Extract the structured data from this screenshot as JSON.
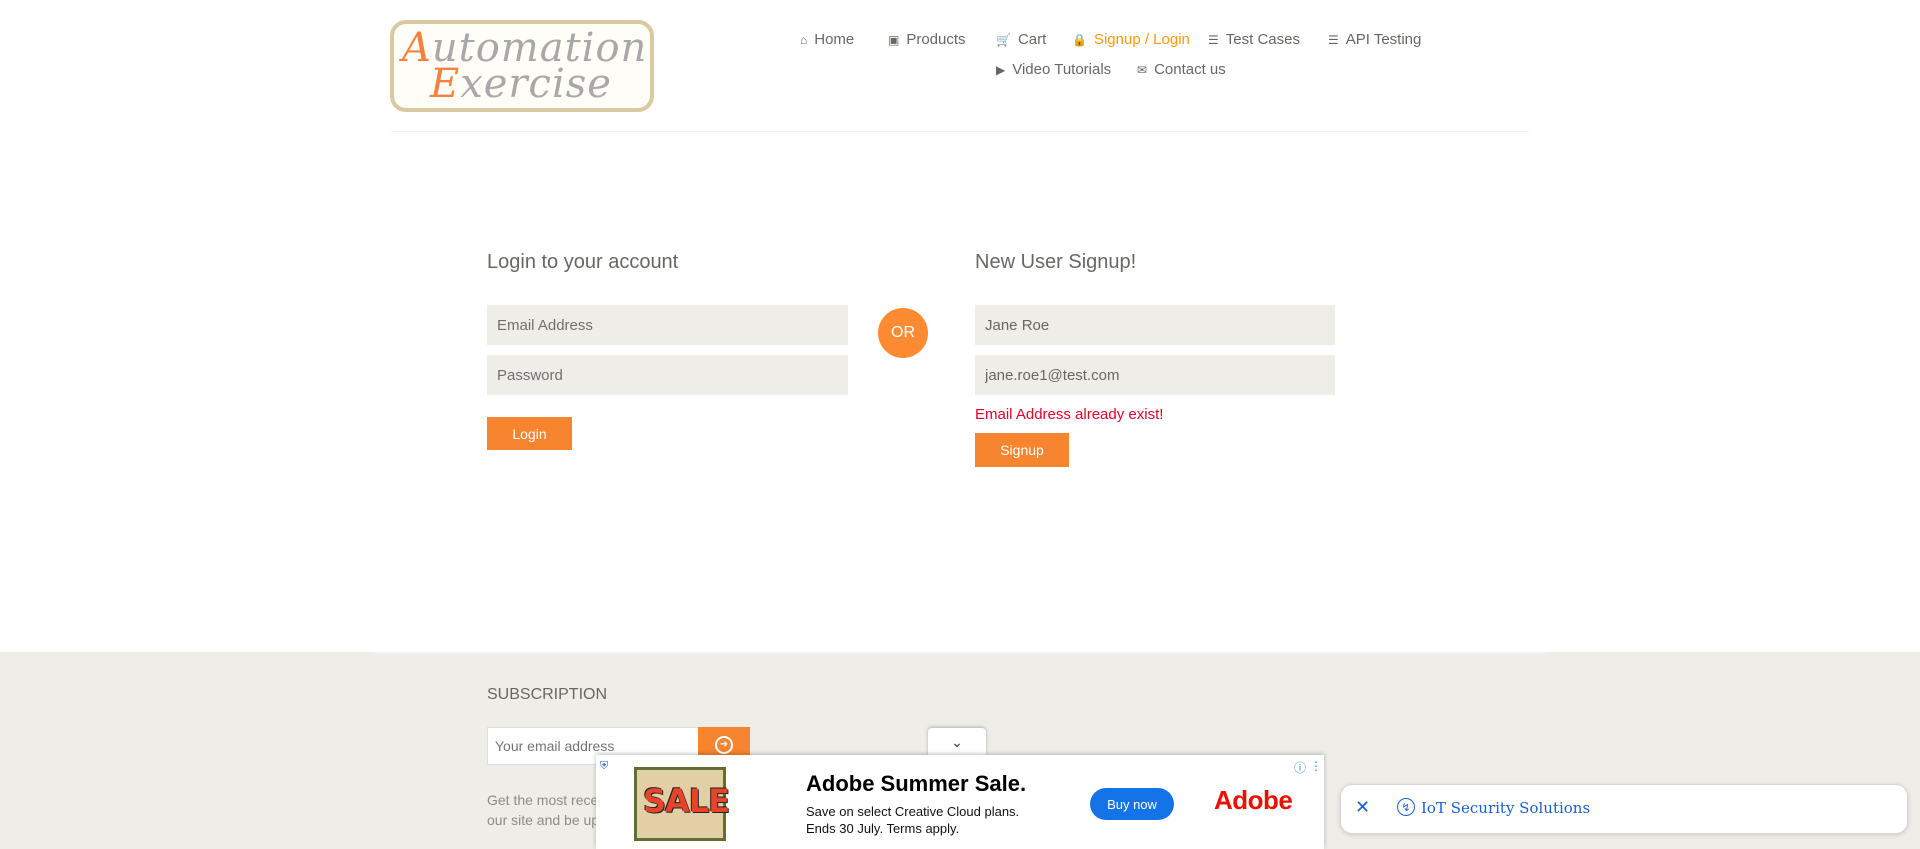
{
  "logo": {
    "line1_cap": "A",
    "line1_rest": "utomation",
    "line2_cap": "E",
    "line2_rest": "xercise"
  },
  "nav": {
    "home": "Home",
    "products": "Products",
    "cart": "Cart",
    "signup_login": "Signup / Login",
    "test_cases": "Test Cases",
    "api_testing": "API Testing",
    "video_tutorials": "Video Tutorials",
    "contact_us": "Contact us",
    "active_color": "#fe980f"
  },
  "login": {
    "title": "Login to your account",
    "email_placeholder": "Email Address",
    "password_placeholder": "Password",
    "button": "Login"
  },
  "or_label": "OR",
  "signup": {
    "title": "New User Signup!",
    "name_value": "Jane Roe",
    "email_value": "jane.roe1@test.com",
    "error": "Email Address already exist!",
    "button": "Signup"
  },
  "footer": {
    "subscription_title": "SUBSCRIPTION",
    "email_placeholder": "Your email address",
    "text_line1": "Get the most rece",
    "text_line2": "our site and be up"
  },
  "ad": {
    "sale_image_text": "SALE",
    "title": "Adobe Summer Sale.",
    "line1": "Save on select Creative Cloud plans.",
    "line2": "Ends 30 July. Terms apply.",
    "button": "Buy now",
    "brand": "Adobe"
  },
  "side_ad": {
    "text": "IoT Security Solutions"
  },
  "colors": {
    "accent": "#fe980f",
    "button": "#f7852f",
    "error": "#e6002a",
    "field_bg": "#eeede8"
  }
}
